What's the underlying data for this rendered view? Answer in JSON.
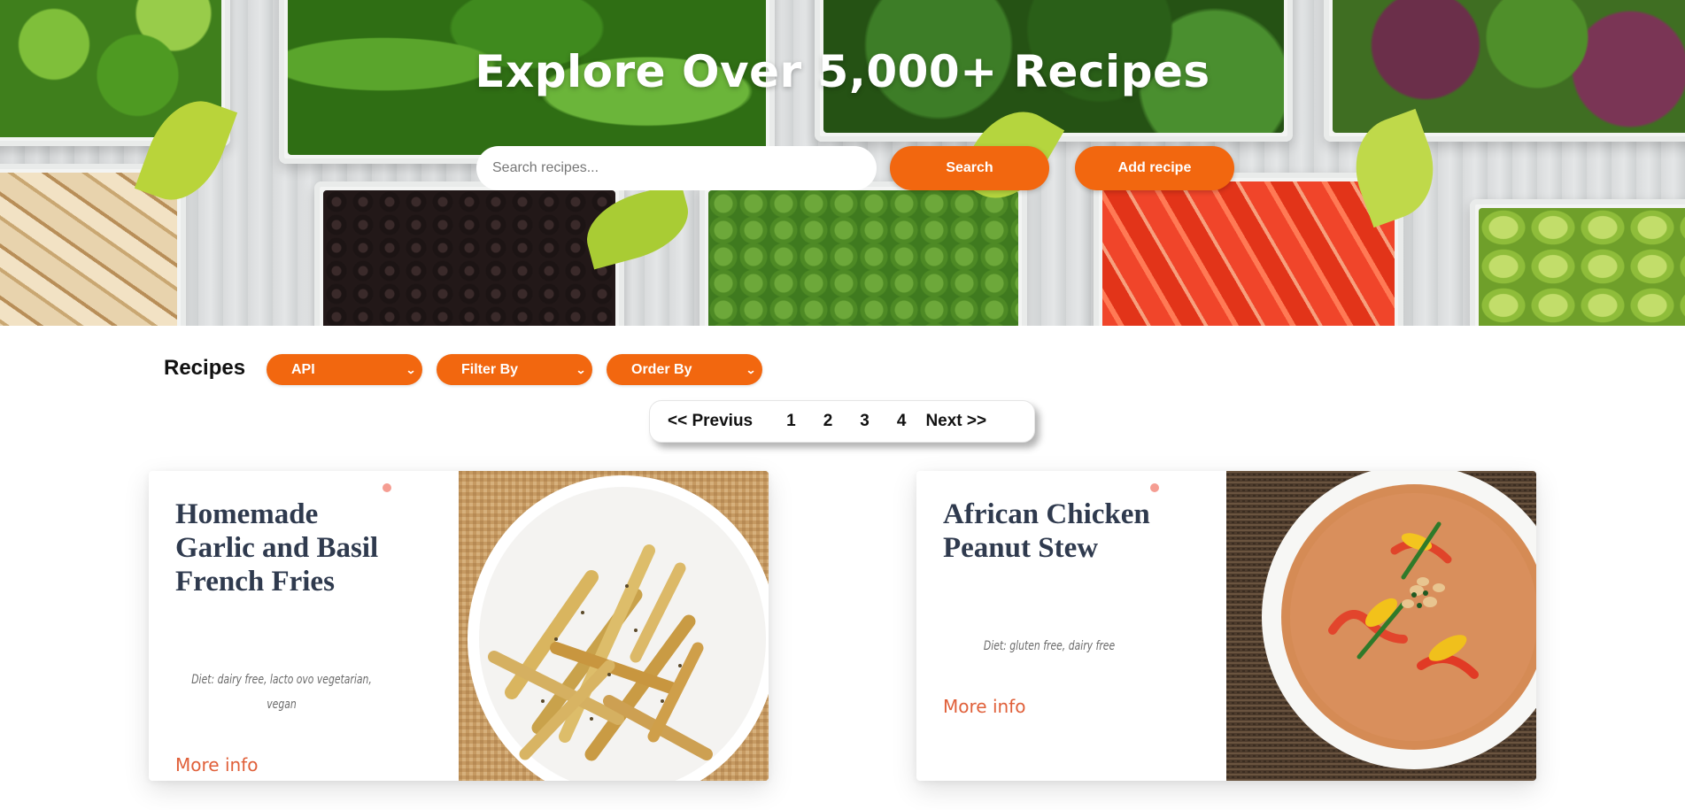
{
  "hero": {
    "title": "Explore Over 5,000+ Recipes",
    "search_placeholder": "Search recipes...",
    "search_button": "Search",
    "add_button": "Add recipe"
  },
  "toolbar": {
    "heading": "Recipes",
    "selects": [
      {
        "selected": "API"
      },
      {
        "selected": "Filter By"
      },
      {
        "selected": "Order By"
      }
    ]
  },
  "pagination": {
    "prev": "<< Previus",
    "pages": [
      "1",
      "2",
      "3",
      "4"
    ],
    "next": "Next >>"
  },
  "cards": [
    {
      "title": "Homemade Garlic and Basil French Fries",
      "diet": "Diet: dairy free, lacto ovo vegetarian, vegan",
      "more": "More info"
    },
    {
      "title": "African Chicken Peanut Stew",
      "diet": "Diet: gluten free, dairy free",
      "more": "More info"
    }
  ],
  "colors": {
    "accent": "#f2670f",
    "link": "#e0603a",
    "card_title": "#2f3a4e",
    "dot": "#f59d92"
  },
  "icons": {
    "select_chevron": "chevron-down-icon"
  }
}
